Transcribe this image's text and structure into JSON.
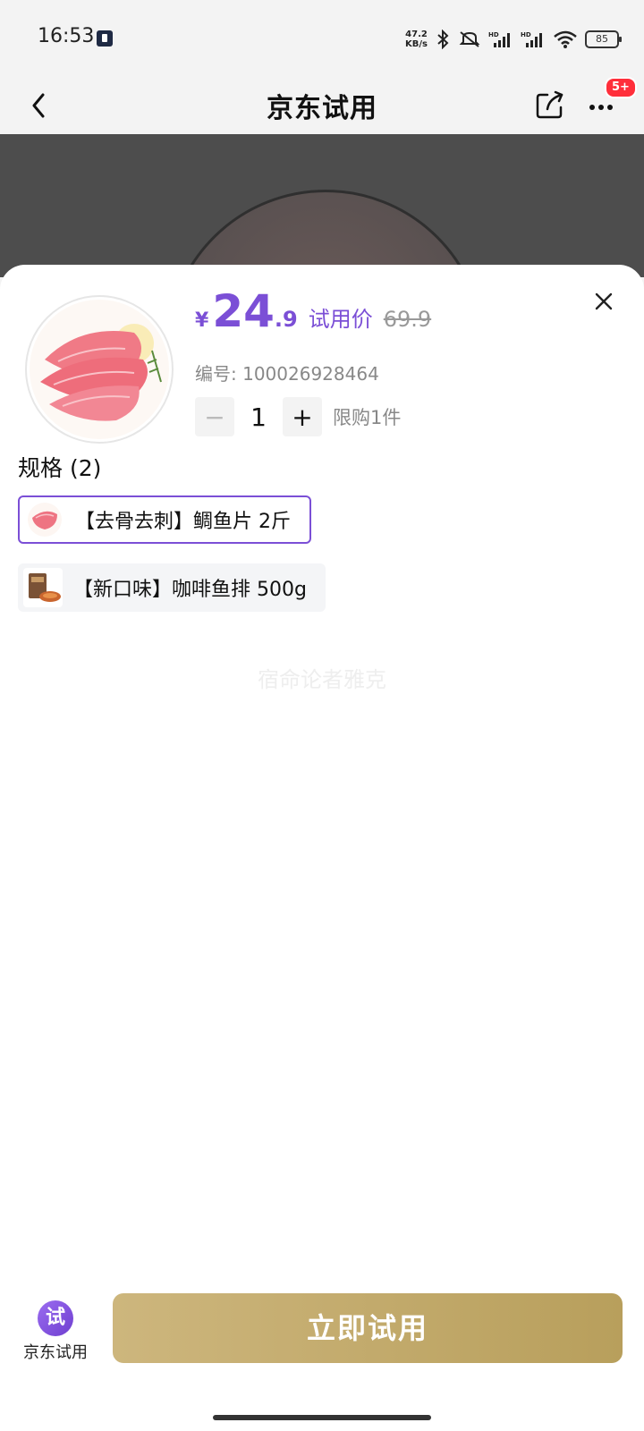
{
  "status_bar": {
    "time": "16:53",
    "net_speed_value": "47.2",
    "net_speed_unit": "KB/s",
    "battery": "85"
  },
  "nav": {
    "title": "京东试用",
    "notification_badge": "5+"
  },
  "product": {
    "currency": "¥",
    "price_int": "24",
    "price_dec": ".9",
    "trial_label": "试用价",
    "original_price": "69.9",
    "sku_line": "编号: 100026928464",
    "quantity": "1",
    "minus_label": "−",
    "plus_label": "+",
    "limit_label": "限购1件"
  },
  "specs": {
    "title": "规格 (2)",
    "options": [
      {
        "label": "【去骨去刺】鲷鱼片 2斤",
        "selected": true
      },
      {
        "label": "【新口味】咖啡鱼排 500g",
        "selected": false
      }
    ]
  },
  "watermark": "宿命论者雅克",
  "bottom": {
    "tab_icon_text": "试",
    "tab_label": "京东试用",
    "cta_label": "立即试用"
  },
  "colors": {
    "accent_purple": "#7b4fd6",
    "cta_gold_start": "#cdb67d",
    "cta_gold_end": "#b89f5c",
    "badge_red": "#ff2e3a"
  }
}
